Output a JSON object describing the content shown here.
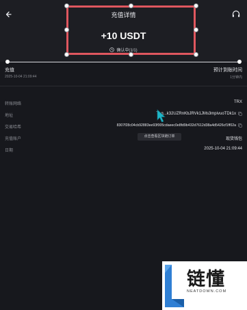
{
  "header": {
    "title": "充值详情",
    "amount": "+10 USDT",
    "status": "确认中(1/1)",
    "back_icon": "back-arrow-icon",
    "support_icon": "headset-icon"
  },
  "timeline": {
    "start_label": "充值",
    "start_time": "2025-10-04 21:09:44",
    "end_label": "预计到账时间",
    "end_time": "1分钟内"
  },
  "details": [
    {
      "label": "转账网络",
      "value": "TRX"
    },
    {
      "label": "地址",
      "value": "TLg...k32UZRnKbJRVk1JMs3mpivuoTDk1x"
    },
    {
      "label": "交易哈希",
      "value": "8307f28c04cb92883ee93f005cdaeec0e8fd9b432d7612d38a4d5426cf1ff02a"
    },
    {
      "label": "充值账户",
      "value": "现货钱包"
    },
    {
      "label": "日期",
      "value": "2025-10-04 21:09:44"
    }
  ],
  "tooltip": "点击查看区块链订单",
  "watermark": {
    "chars": "链懂",
    "domain": "NEATDOWN.COM"
  },
  "colors": {
    "background": "#17181d",
    "highlight": "#e0575f",
    "cursor": "#1fb6c8"
  }
}
